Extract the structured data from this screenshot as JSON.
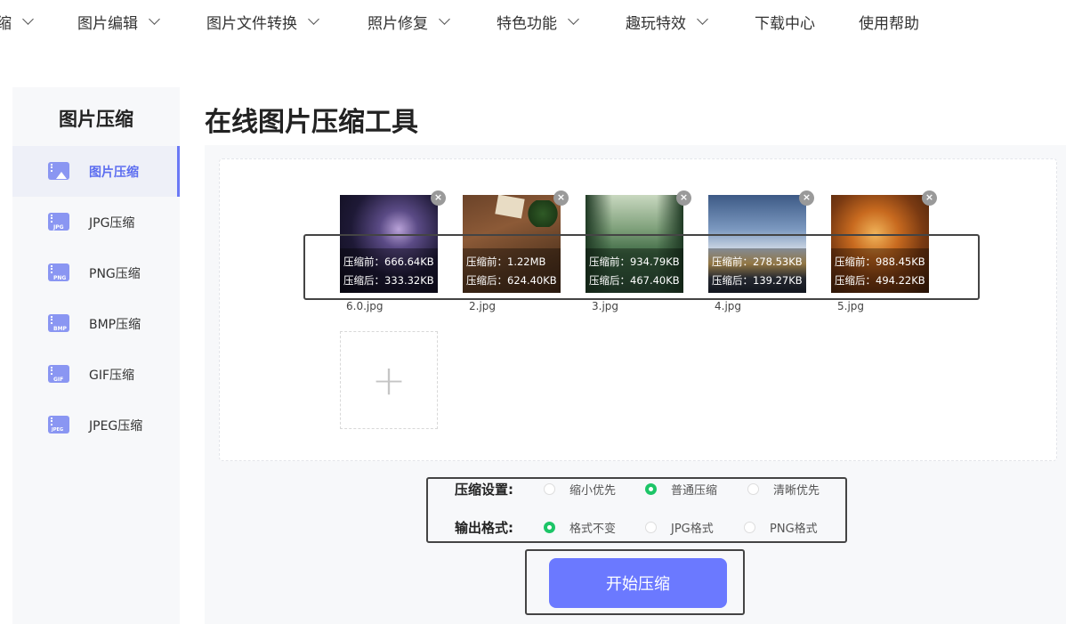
{
  "nav": [
    {
      "label": "缩",
      "has_menu": true
    },
    {
      "label": "图片编辑",
      "has_menu": true
    },
    {
      "label": "图片文件转换",
      "has_menu": true
    },
    {
      "label": "照片修复",
      "has_menu": true
    },
    {
      "label": "特色功能",
      "has_menu": true
    },
    {
      "label": "趣玩特效",
      "has_menu": true
    },
    {
      "label": "下载中心",
      "has_menu": false
    },
    {
      "label": "使用帮助",
      "has_menu": false
    }
  ],
  "sidebar": {
    "title": "图片压缩",
    "items": [
      {
        "label": "图片压缩",
        "icon": "image-compress-icon",
        "active": true
      },
      {
        "label": "JPG压缩",
        "icon": "jpg-file-icon",
        "tag": "JPG"
      },
      {
        "label": "PNG压缩",
        "icon": "png-file-icon",
        "tag": "PNG"
      },
      {
        "label": "BMP压缩",
        "icon": "bmp-file-icon",
        "tag": "BMP"
      },
      {
        "label": "GIF压缩",
        "icon": "gif-file-icon",
        "tag": "GIF"
      },
      {
        "label": "JPEG压缩",
        "icon": "jpeg-file-icon",
        "tag": "JPEG"
      }
    ]
  },
  "main": {
    "title": "在线图片压缩工具",
    "files": [
      {
        "name": "6.0.jpg",
        "before": "压缩前：666.64KB",
        "after": "压缩后：333.32KB"
      },
      {
        "name": "2.jpg",
        "before": "压缩前：1.22MB",
        "after": "压缩后：624.40KB"
      },
      {
        "name": "3.jpg",
        "before": "压缩前：934.79KB",
        "after": "压缩后：467.40KB"
      },
      {
        "name": "4.jpg",
        "before": "压缩前：278.53KB",
        "after": "压缩后：139.27KB"
      },
      {
        "name": "5.jpg",
        "before": "压缩前：988.45KB",
        "after": "压缩后：494.22KB"
      }
    ],
    "close_glyph": "×",
    "add_glyph": "+",
    "settings": {
      "compress_label": "压缩设置:",
      "compress_options": [
        {
          "label": "缩小优先",
          "selected": false
        },
        {
          "label": "普通压缩",
          "selected": true
        },
        {
          "label": "清晰优先",
          "selected": false
        }
      ],
      "format_label": "输出格式:",
      "format_options": [
        {
          "label": "格式不变",
          "selected": true
        },
        {
          "label": "JPG格式",
          "selected": false
        },
        {
          "label": "PNG格式",
          "selected": false
        }
      ]
    },
    "start_button": "开始压缩"
  },
  "colors": {
    "accent": "#6b79ff",
    "radio_on": "#1dc567",
    "sidebar_bg": "#f7f8fa"
  }
}
